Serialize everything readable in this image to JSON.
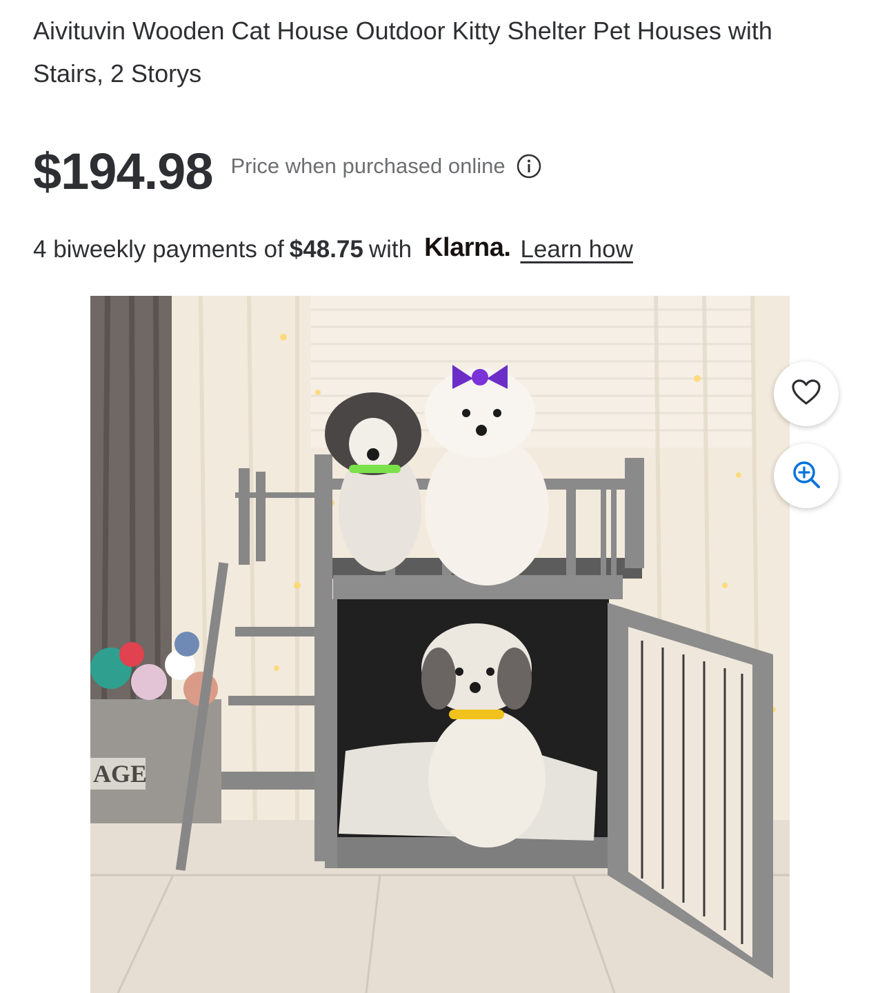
{
  "product": {
    "title": "Aivituvin Wooden Cat House Outdoor Kitty Shelter Pet Houses with Stairs, 2 Storys",
    "price": "$194.98",
    "price_note": "Price when purchased online"
  },
  "financing": {
    "prefix": "4 biweekly payments of",
    "amount": "$48.75",
    "connector": "with",
    "provider": "Klarna.",
    "learn_link": "Learn how"
  },
  "image": {
    "basket_label": "AGE",
    "alt": "Two-story grey wooden pet house with stairs and three small dogs"
  },
  "actions": {
    "favorite_icon": "heart-icon",
    "zoom_icon": "zoom-in-icon"
  },
  "colors": {
    "text": "#2e2f32",
    "muted": "#6d6e71",
    "accent_blue": "#0071dc"
  }
}
